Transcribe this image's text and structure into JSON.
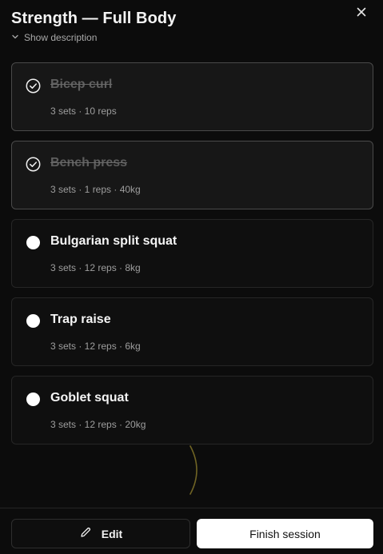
{
  "header": {
    "title": "Strength — Full Body",
    "description_toggle": "Show description"
  },
  "exercises": [
    {
      "name": "Bicep curl",
      "meta": "3 sets · 10 reps",
      "done": true
    },
    {
      "name": "Bench press",
      "meta": "3 sets · 1 reps · 40kg",
      "done": true
    },
    {
      "name": "Bulgarian split squat",
      "meta": "3 sets · 12 reps · 8kg",
      "done": false
    },
    {
      "name": "Trap raise",
      "meta": "3 sets · 12 reps · 6kg",
      "done": false
    },
    {
      "name": "Goblet squat",
      "meta": "3 sets · 12 reps · 20kg",
      "done": false
    }
  ],
  "footer": {
    "edit_label": "Edit",
    "finish_label": "Finish session"
  },
  "colors": {
    "background": "#0c0c0c",
    "card_done": "#171717",
    "primary_button": "#ffffff",
    "spinner_accent": "#8a7a2a"
  },
  "icons": {
    "close": "close-icon",
    "chevron": "chevron-down-icon",
    "check": "check-circle-icon",
    "edit": "pencil-icon"
  }
}
